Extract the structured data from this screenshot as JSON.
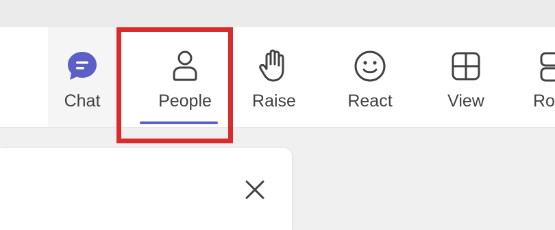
{
  "toolbar": {
    "buttons": [
      {
        "id": "chat",
        "label": "Chat",
        "icon": "chat-bubble-icon",
        "active": false
      },
      {
        "id": "people",
        "label": "People",
        "icon": "person-icon",
        "active": true
      },
      {
        "id": "raise",
        "label": "Raise",
        "icon": "raised-hand-icon",
        "active": false
      },
      {
        "id": "react",
        "label": "React",
        "icon": "smiley-face-icon",
        "active": false
      },
      {
        "id": "view",
        "label": "View",
        "icon": "grid-view-icon",
        "active": false
      },
      {
        "id": "rooms",
        "label": "Ro",
        "icon": "rooms-icon",
        "active": false
      }
    ]
  },
  "panel": {
    "close_icon": "close-icon"
  },
  "colors": {
    "accent": "#5b5fc7",
    "highlight": "#d92b2b",
    "label": "#424242",
    "icon_stroke": "#424242"
  }
}
